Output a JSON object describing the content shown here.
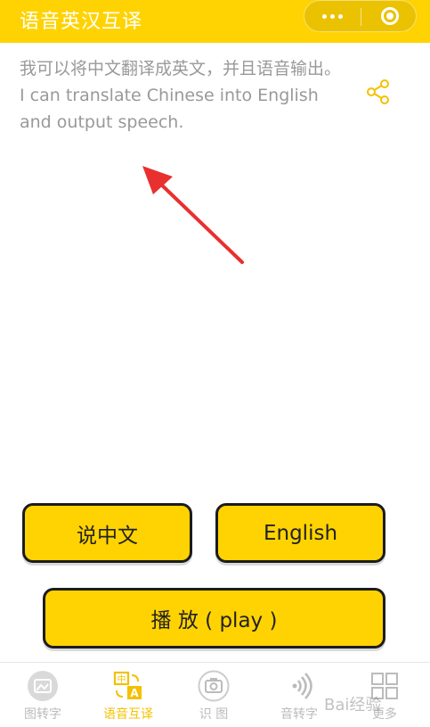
{
  "header": {
    "title": "语音英汉互译"
  },
  "content": {
    "chinese_text": "我可以将中文翻译成英文，并且语音输出。",
    "english_text": "I can translate Chinese into English and output speech."
  },
  "buttons": {
    "speak_chinese": "说中文",
    "english": "English",
    "play": "播 放 ( play )"
  },
  "tabbar": {
    "items": [
      {
        "label": "图转字",
        "icon": "image-icon"
      },
      {
        "label": "语音互译",
        "icon": "translate-icon",
        "active": true
      },
      {
        "label": "识 图",
        "icon": "camera-icon"
      },
      {
        "label": "音转字",
        "icon": "sound-icon"
      },
      {
        "label": "更多",
        "icon": "grid-icon"
      }
    ]
  },
  "watermark": {
    "text": "Bai经验"
  },
  "colors": {
    "accent": "#ffd302",
    "text_muted": "#999999",
    "tab_active": "#f5c000"
  }
}
